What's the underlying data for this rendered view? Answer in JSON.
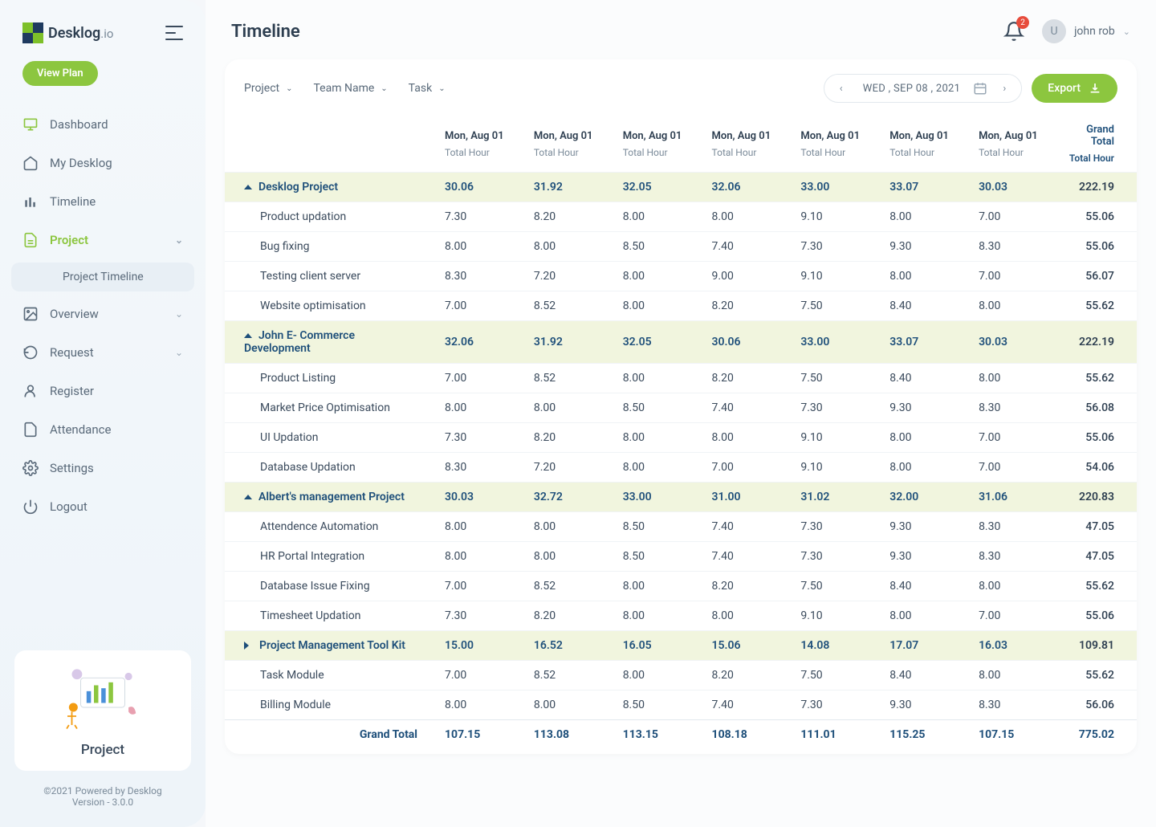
{
  "brand": {
    "name": "Desklog",
    "suffix": ".io"
  },
  "view_plan": "View Plan",
  "nav": {
    "dashboard": "Dashboard",
    "my_desklog": "My Desklog",
    "timeline": "Timeline",
    "project": "Project",
    "project_sub": "Project Timeline",
    "overview": "Overview",
    "request": "Request",
    "register": "Register",
    "attendance": "Attendance",
    "settings": "Settings",
    "logout": "Logout"
  },
  "promo": {
    "title": "Project"
  },
  "footer": {
    "line1": "©2021 Powered by Desklog",
    "line2": "Version - 3.0.0"
  },
  "page_title": "Timeline",
  "notif_count": "2",
  "user": {
    "initial": "U",
    "name": "john rob"
  },
  "filters": {
    "project": "Project",
    "team": "Team Name",
    "task": "Task"
  },
  "date": "WED , SEP 08 , 2021",
  "export_label": "Export",
  "columns": {
    "d0": "Mon, Aug 01",
    "d1": "Mon, Aug 01",
    "d2": "Mon, Aug 01",
    "d3": "Mon, Aug 01",
    "d4": "Mon, Aug 01",
    "d5": "Mon, Aug 01",
    "d6": "Mon, Aug 01",
    "gt": "Grand Total",
    "sub": "Total Hour"
  },
  "sections": [
    {
      "name": "Desklog Project",
      "collapsed": false,
      "totals": [
        "30.06",
        "31.92",
        "32.05",
        "32.06",
        "33.00",
        "33.07",
        "30.03",
        "222.19"
      ],
      "rows": [
        {
          "name": "Product updation",
          "v": [
            "7.30",
            "8.20",
            "8.00",
            "8.00",
            "9.10",
            "8.00",
            "7.00",
            "55.06"
          ]
        },
        {
          "name": "Bug fixing",
          "v": [
            "8.00",
            "8.00",
            "8.50",
            "7.40",
            "7.30",
            "9.30",
            "8.30",
            "55.06"
          ]
        },
        {
          "name": "Testing client server",
          "v": [
            "8.30",
            "7.20",
            "8.00",
            "9.00",
            "9.10",
            "8.00",
            "7.00",
            "56.07"
          ]
        },
        {
          "name": "Website optimisation",
          "v": [
            "7.00",
            "8.52",
            "8.00",
            "8.20",
            "7.50",
            "8.40",
            "8.00",
            "55.62"
          ]
        }
      ]
    },
    {
      "name": "John E- Commerce Development",
      "collapsed": false,
      "totals": [
        "32.06",
        "31.92",
        "32.05",
        "30.06",
        "33.00",
        "33.07",
        "30.03",
        "222.19"
      ],
      "rows": [
        {
          "name": "Product Listing",
          "v": [
            "7.00",
            "8.52",
            "8.00",
            "8.20",
            "7.50",
            "8.40",
            "8.00",
            "55.62"
          ]
        },
        {
          "name": "Market Price Optimisation",
          "v": [
            "8.00",
            "8.00",
            "8.50",
            "7.40",
            "7.30",
            "9.30",
            "8.30",
            "56.08"
          ]
        },
        {
          "name": "UI Updation",
          "v": [
            "7.30",
            "8.20",
            "8.00",
            "8.00",
            "9.10",
            "8.00",
            "7.00",
            "55.06"
          ]
        },
        {
          "name": "Database Updation",
          "v": [
            "8.30",
            "7.20",
            "8.00",
            "7.00",
            "9.10",
            "8.00",
            "7.00",
            "54.06"
          ]
        }
      ]
    },
    {
      "name": "Albert's management Project",
      "collapsed": false,
      "totals": [
        "30.03",
        "32.72",
        "33.00",
        "31.00",
        "31.02",
        "32.00",
        "31.06",
        "220.83"
      ],
      "rows": [
        {
          "name": "Attendence Automation",
          "v": [
            "8.00",
            "8.00",
            "8.50",
            "7.40",
            "7.30",
            "9.30",
            "8.30",
            "47.05"
          ]
        },
        {
          "name": "HR Portal Integration",
          "v": [
            "8.00",
            "8.00",
            "8.50",
            "7.40",
            "7.30",
            "9.30",
            "8.30",
            "47.05"
          ]
        },
        {
          "name": "Database  Issue Fixing",
          "v": [
            "7.00",
            "8.52",
            "8.00",
            "8.20",
            "7.50",
            "8.40",
            "8.00",
            "55.62"
          ]
        },
        {
          "name": "Timesheet Updation",
          "v": [
            "7.30",
            "8.20",
            "8.00",
            "8.00",
            "9.10",
            "8.00",
            "7.00",
            "55.06"
          ]
        }
      ]
    },
    {
      "name": "Project Management Tool Kit",
      "collapsed": true,
      "totals": [
        "15.00",
        "16.52",
        "16.05",
        "15.06",
        "14.08",
        "17.07",
        "16.03",
        "109.81"
      ],
      "rows": [
        {
          "name": "Task Module",
          "v": [
            "7.00",
            "8.52",
            "8.00",
            "8.20",
            "7.50",
            "8.40",
            "8.00",
            "55.62"
          ]
        },
        {
          "name": "Billing Module",
          "v": [
            "8.00",
            "8.00",
            "8.50",
            "7.40",
            "7.30",
            "9.30",
            "8.30",
            "56.06"
          ]
        }
      ]
    }
  ],
  "grand": {
    "label": "Grand Total",
    "v": [
      "107.15",
      "113.08",
      "113.15",
      "108.18",
      "111.01",
      "115.25",
      "107.15",
      "775.02"
    ]
  }
}
